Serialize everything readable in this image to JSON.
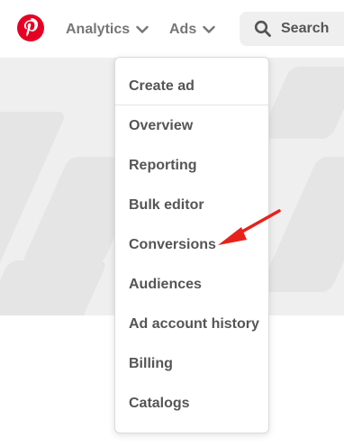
{
  "header": {
    "logo_icon": "pinterest-logo-icon",
    "brand_color": "#e60023",
    "nav": [
      {
        "label": "Analytics",
        "icon": "chevron-down-icon"
      },
      {
        "label": "Ads",
        "icon": "chevron-down-icon"
      }
    ],
    "search": {
      "placeholder": "Search",
      "icon": "search-icon"
    }
  },
  "ads_menu": {
    "items": [
      {
        "label": "Create ad"
      },
      {
        "label": "Overview"
      },
      {
        "label": "Reporting"
      },
      {
        "label": "Bulk editor"
      },
      {
        "label": "Conversions"
      },
      {
        "label": "Audiences"
      },
      {
        "label": "Ad account history"
      },
      {
        "label": "Billing"
      },
      {
        "label": "Catalogs"
      }
    ]
  },
  "annotation": {
    "icon": "red-arrow-icon",
    "color": "#e8211a"
  }
}
